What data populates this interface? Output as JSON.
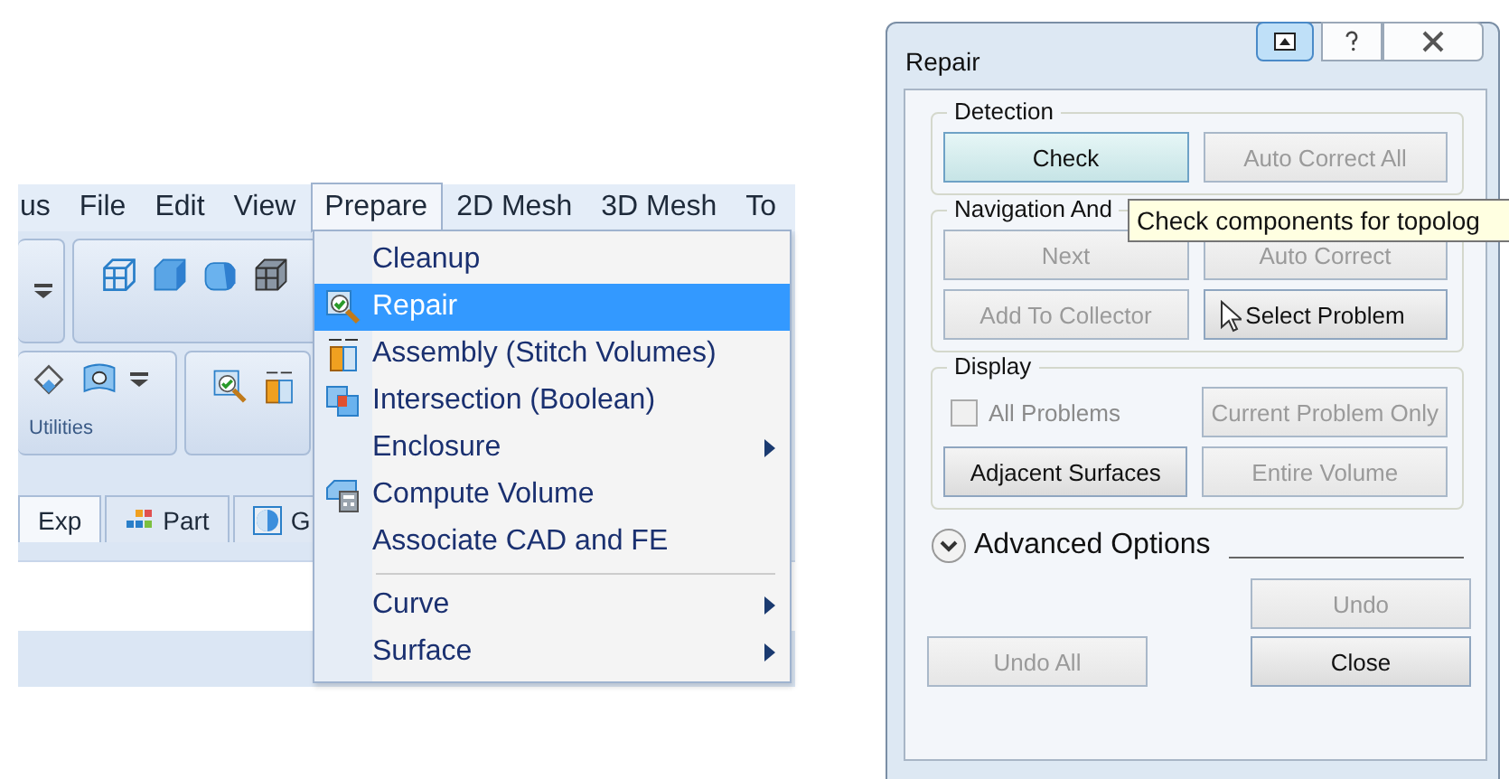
{
  "menubar": {
    "items": [
      {
        "label": "us",
        "selected": false
      },
      {
        "label": "File",
        "selected": false
      },
      {
        "label": "Edit",
        "selected": false
      },
      {
        "label": "View",
        "selected": false
      },
      {
        "label": "Prepare",
        "selected": true
      },
      {
        "label": "2D Mesh",
        "selected": false
      },
      {
        "label": "3D Mesh",
        "selected": false
      },
      {
        "label": "To",
        "selected": false
      }
    ]
  },
  "toolbar": {
    "group_label": "Utilities"
  },
  "tabs": [
    {
      "label": "Exp",
      "selected": true
    },
    {
      "label": "Part",
      "selected": false
    },
    {
      "label": "G",
      "selected": false
    }
  ],
  "menu": {
    "items": [
      {
        "kind": "item",
        "label": "Cleanup",
        "selected": false,
        "submenu": false
      },
      {
        "kind": "item",
        "label": "Repair",
        "selected": true,
        "submenu": false
      },
      {
        "kind": "item",
        "label": "Assembly (Stitch Volumes)",
        "selected": false,
        "submenu": false
      },
      {
        "kind": "item",
        "label": "Intersection (Boolean)",
        "selected": false,
        "submenu": false
      },
      {
        "kind": "item",
        "label": "Enclosure",
        "selected": false,
        "submenu": true
      },
      {
        "kind": "item",
        "label": "Compute Volume",
        "selected": false,
        "submenu": false
      },
      {
        "kind": "item",
        "label": "Associate CAD and FE",
        "selected": false,
        "submenu": false
      },
      {
        "kind": "separator"
      },
      {
        "kind": "item",
        "label": "Curve",
        "selected": false,
        "submenu": true
      },
      {
        "kind": "item",
        "label": "Surface",
        "selected": false,
        "submenu": true
      }
    ]
  },
  "dialog": {
    "title": "Repair",
    "groups": [
      {
        "title": "Detection",
        "controls": [
          {
            "kind": "button",
            "label": "Check",
            "disabled": false,
            "hovered": true,
            "pointer": false
          },
          {
            "kind": "button",
            "label": "Auto Correct All",
            "disabled": true,
            "hovered": false,
            "pointer": false
          }
        ]
      },
      {
        "title": "Navigation And",
        "controls": [
          {
            "kind": "button",
            "label": "Next",
            "disabled": true,
            "hovered": false,
            "pointer": false
          },
          {
            "kind": "button",
            "label": "Auto Correct",
            "disabled": true,
            "hovered": false,
            "pointer": false
          },
          {
            "kind": "button",
            "label": "Add To Collector",
            "disabled": true,
            "hovered": false,
            "pointer": false
          },
          {
            "kind": "button",
            "label": "Select Problem",
            "disabled": false,
            "hovered": false,
            "pointer": true
          }
        ]
      },
      {
        "title": "Display",
        "controls": [
          {
            "kind": "checkbox",
            "label": "All Problems",
            "disabled": true,
            "checked": false
          },
          {
            "kind": "button",
            "label": "Current Problem Only",
            "disabled": true,
            "hovered": false,
            "pointer": false
          },
          {
            "kind": "button",
            "label": "Adjacent Surfaces",
            "disabled": false,
            "hovered": false,
            "pointer": false
          },
          {
            "kind": "button",
            "label": "Entire Volume",
            "disabled": true,
            "hovered": false,
            "pointer": false
          }
        ]
      }
    ],
    "tooltip": "Check components for topolog",
    "advanced": {
      "label": "Advanced Options",
      "expanded": false
    },
    "buttons": [
      {
        "label": "Undo",
        "disabled": true
      },
      {
        "label": "Undo All",
        "disabled": true
      },
      {
        "label": "Close",
        "disabled": false
      }
    ]
  }
}
